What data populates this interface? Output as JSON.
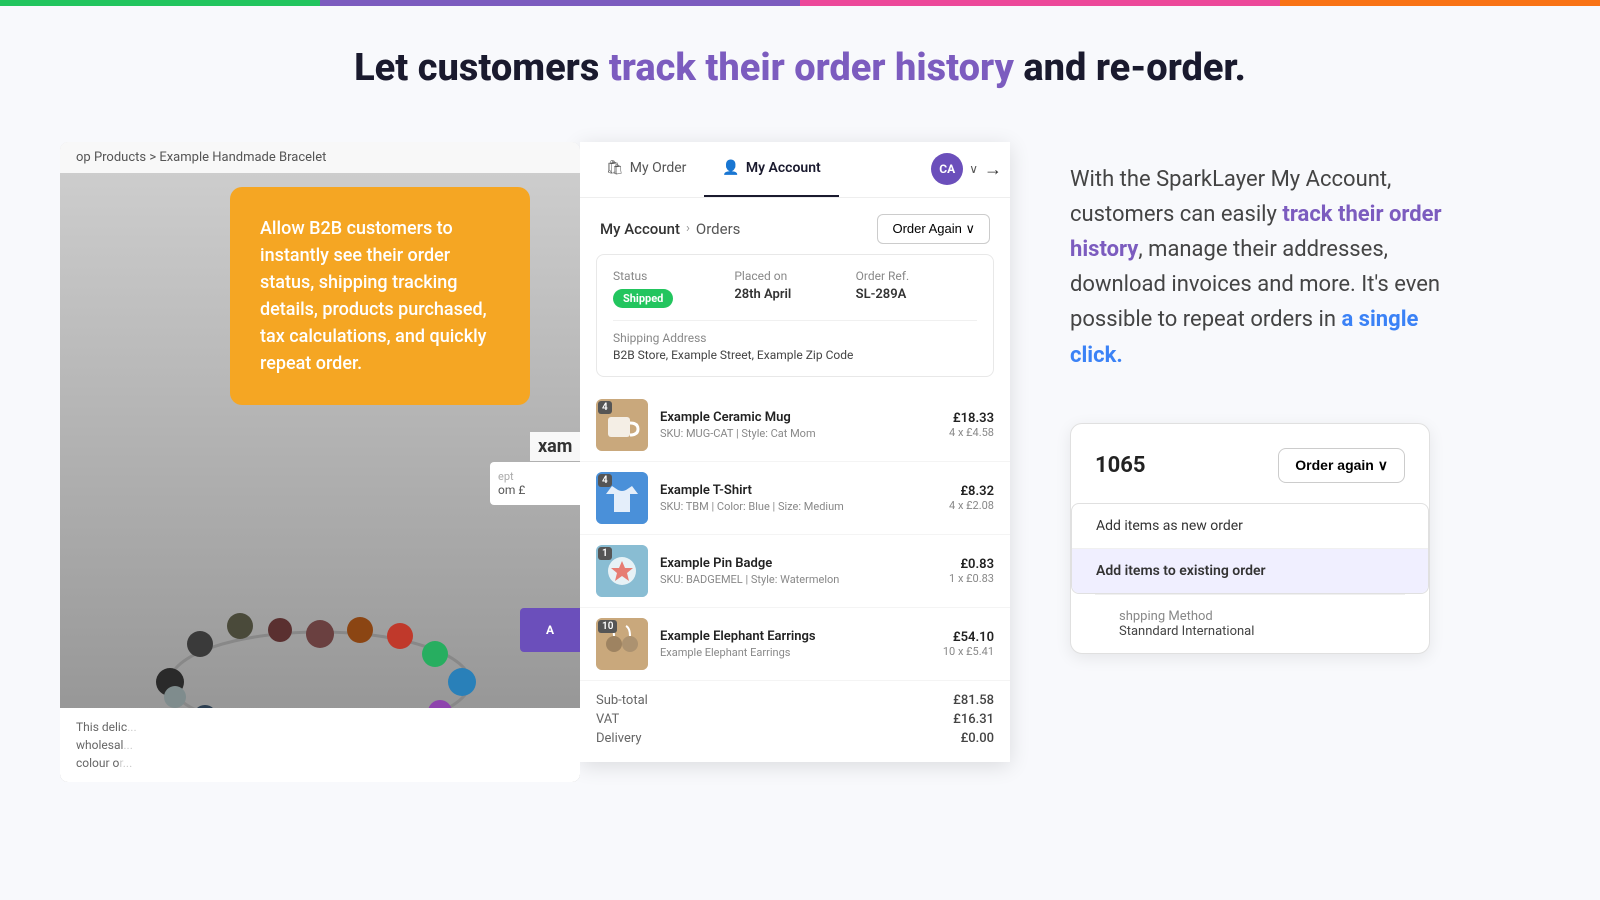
{
  "topbar": {
    "segments": [
      {
        "color": "#22c55e",
        "flex": 2
      },
      {
        "color": "#7c5cbf",
        "flex": 3
      },
      {
        "color": "#ec4899",
        "flex": 3
      },
      {
        "color": "#f97316",
        "flex": 2
      }
    ]
  },
  "headline": {
    "part1": "Let customers ",
    "highlight": "track their order history",
    "part2": " and re-order."
  },
  "tooltip": {
    "text": "Allow B2B customers to instantly see their order status, shipping tracking details, products purchased, tax calculations, and quickly repeat order."
  },
  "breadcrumb_page": {
    "text": "op Products > Example Handmade Bracelet"
  },
  "nav": {
    "my_order": "My Order",
    "my_account": "My Account",
    "avatar_initials": "CA",
    "chevron": "∨",
    "arrow": "→"
  },
  "panel": {
    "breadcrumb_link": "My Account",
    "breadcrumb_current": "Orders",
    "order_again_btn": "Order Again ∨"
  },
  "order_meta": {
    "status_label": "Status",
    "status_value": "Shipped",
    "placed_on_label": "Placed on",
    "placed_on_value": "28th April",
    "ref_label": "Order Ref.",
    "ref_value": "SL-289A",
    "shipping_label": "Shipping Address",
    "shipping_addr": "B2B Store, Example Street, Example Zip Code"
  },
  "products": [
    {
      "count": "4",
      "name": "Example Ceramic Mug",
      "sku": "SKU: MUG-CAT | Style: Cat Mom",
      "total": "£18.33",
      "unit": "4 x £4.58",
      "thumb_class": "thumb-mug"
    },
    {
      "count": "4",
      "name": "Example T-Shirt",
      "sku": "SKU: TBM | Color: Blue | Size: Medium",
      "total": "£8.32",
      "unit": "4 x £2.08",
      "thumb_class": "thumb-tshirt"
    },
    {
      "count": "1",
      "name": "Example Pin Badge",
      "sku": "SKU: BADGEMEL | Style: Watermelon",
      "total": "£0.83",
      "unit": "1 x £0.83",
      "thumb_class": "thumb-badge"
    },
    {
      "count": "10",
      "name": "Example Elephant Earrings",
      "sku": "Example Elephant Earrings",
      "total": "£54.10",
      "unit": "10 x £5.41",
      "thumb_class": "thumb-earrings"
    }
  ],
  "totals": [
    {
      "label": "Sub-total",
      "value": "£81.58"
    },
    {
      "label": "VAT",
      "value": "£16.31"
    },
    {
      "label": "Delivery",
      "value": "£0.00"
    }
  ],
  "right_text": {
    "part1": "With the SparkLayer My Account, customers can easily ",
    "highlight1": "track their order history",
    "part2": ", manage their addresses, download invoices and more. It's even possible to repeat orders in ",
    "highlight2": "a single click.",
    "end": ""
  },
  "order_again_card": {
    "order_number": "1065",
    "trigger_label": "Order again ∨",
    "option1": "Add items as new order",
    "option2": "Add items to existing order",
    "shipping_label": "pping Method",
    "shipping_value": "ndard International"
  }
}
